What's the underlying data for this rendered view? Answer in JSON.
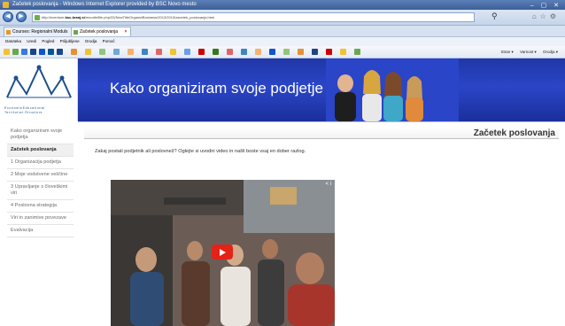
{
  "window": {
    "title": "Začetek poslovanja - Windows Internet Explorer provided by BSC Novo mesto"
  },
  "address": {
    "url_prefix": "http://eventum.",
    "url_domain": "bsc-kranj.si",
    "url_suffix": "/moodle/file.php/33/NewTitleOrganiziBusiness/2013/2013/zacetek_poslovanja.html"
  },
  "tabs": [
    {
      "label": "Courses: Regionalni Moduls"
    },
    {
      "label": "Začetek poslovanja"
    }
  ],
  "menu": [
    "Datoteka",
    "Uredi",
    "Pogled",
    "Priljubljene",
    "Orodja",
    "Pomoč"
  ],
  "command_bar": [
    "Stran ▾",
    "Varnost ▾",
    "Orodja ▾"
  ],
  "logo": {
    "line1": "EconomicEducational",
    "line2": "Territorial-Structure"
  },
  "banner": {
    "title": "Kako organiziram svoje podjetje"
  },
  "sidebar": {
    "items": [
      {
        "label": "Kako organiziram svoje podjetja"
      },
      {
        "label": "Začetek poslovanja"
      },
      {
        "label": "1 Organizacija podjetja"
      },
      {
        "label": "2 Moje vodstvene veščine"
      },
      {
        "label": "3 Upravljanje s človeškimi viri"
      },
      {
        "label": "4 Poslovna strategija"
      },
      {
        "label": "Viri in zanimive povezave"
      },
      {
        "label": "Evalvacija"
      }
    ]
  },
  "main": {
    "title": "Začetek poslovanja",
    "intro": "Zakaj postati podjetnik ali poslovnež? Oglejte si uvodni video in našli boste vsaj en dober razlog."
  },
  "video": {
    "corner": "< i"
  },
  "colors": {
    "banner_blue": "#2037a8",
    "play_red": "#e62117",
    "window_blue": "#3d5f97"
  }
}
